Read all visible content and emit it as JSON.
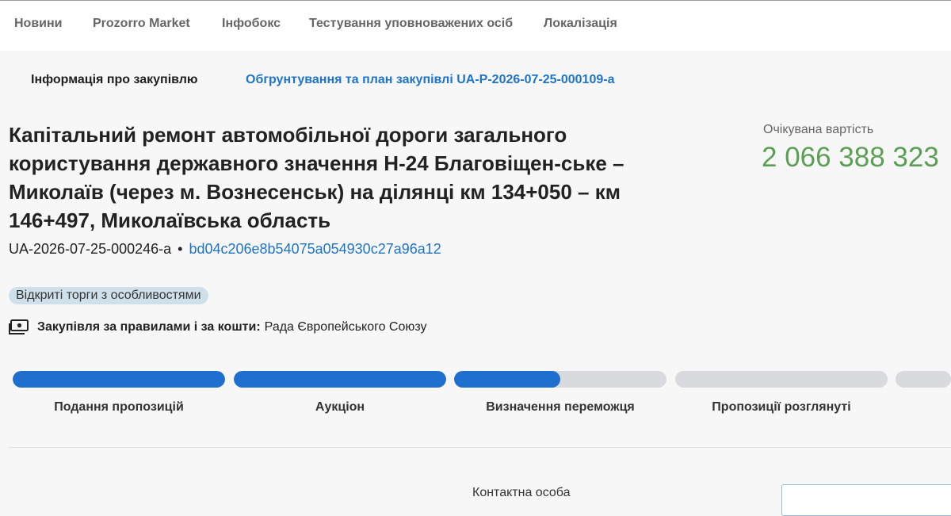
{
  "nav": {
    "items": [
      {
        "label": "Новини"
      },
      {
        "label": "Prozorro Market"
      },
      {
        "label": "Інфобокс"
      },
      {
        "label": "Тестування уповноважених осіб"
      },
      {
        "label": "Локалізація"
      }
    ]
  },
  "tabs": {
    "info": "Інформація про закупівлю",
    "plan": "Обгрунтування та план закупівлі UA-P-2026-07-25-000109-a"
  },
  "tender": {
    "title": "Капітальний ремонт автомобільної дороги загального користування державного значення Н-24 Благовіщен-ське – Миколаїв (через м. Вознесенськ) на ділянці км 134+050 – км 146+497, Миколаївська область",
    "code": "UA-2026-07-25-000246-a",
    "separator": "•",
    "hash": "bd04c206e8b54075a054930c27a96a12",
    "badge": "Відкриті торги з особливостями",
    "rules_label": "Закупівля за правилами і за кошти:",
    "rules_value": "Рада Європейського Союзу",
    "rules_icon": "money-icon"
  },
  "expected": {
    "label": "Очікувана вартість",
    "value": "2 066 388 323"
  },
  "stages": [
    {
      "label": "Подання пропозицій",
      "progress": 1.0
    },
    {
      "label": "Аукціон",
      "progress": 1.0
    },
    {
      "label": "Визначення переможця",
      "progress": 0.5
    },
    {
      "label": "Пропозиції розглянуті",
      "progress": 0.0
    },
    {
      "label": "",
      "progress": 0.0
    }
  ],
  "contact": {
    "label": "Контактна особа"
  },
  "colors": {
    "accent": "#1f74c7",
    "progress": "#1f6fcf",
    "price": "#5b9f55",
    "badge_bg": "#cfe0ea"
  }
}
